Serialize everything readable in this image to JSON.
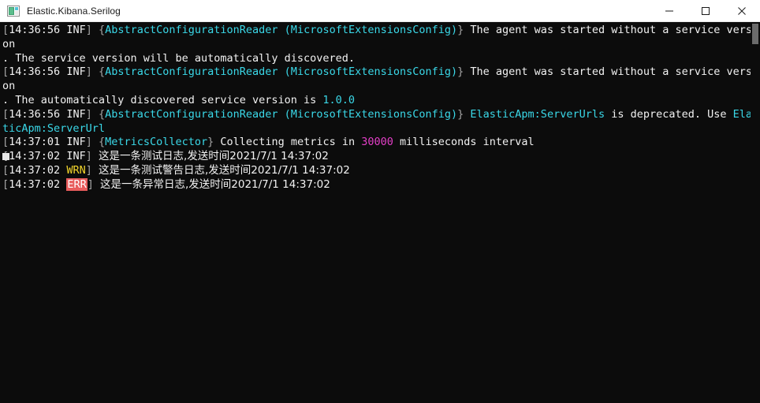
{
  "window": {
    "title": "Elastic.Kibana.Serilog",
    "icon": "console-app-icon",
    "controls": {
      "minimize_label": "Minimize",
      "maximize_label": "Maximize",
      "close_label": "Close"
    }
  },
  "colors": {
    "console_background": "#0c0c0c",
    "titlebar_background": "#ffffff",
    "default_text": "#f2f2f2",
    "bracket_gray": "#a5a5a5",
    "cyan_accent": "#3ad8e8",
    "magenta_accent": "#e43fc8",
    "warning_yellow": "#f5d72c",
    "error_badge_background": "#e85c5c",
    "error_badge_text": "#ffffff",
    "scrollbar_thumb": "#6b6b6b"
  },
  "console": {
    "lines": [
      {
        "id": "line-1",
        "level": "INF",
        "segments": [
          {
            "text": "[",
            "color": "gray"
          },
          {
            "text": "14:36:56",
            "color": "white"
          },
          {
            "text": " ",
            "color": "white"
          },
          {
            "text": "INF",
            "color": "white"
          },
          {
            "text": "] ",
            "color": "gray"
          },
          {
            "text": "{",
            "color": "gray"
          },
          {
            "text": "AbstractConfigurationReader (MicrosoftExtensionsConfig)",
            "color": "cyan"
          },
          {
            "text": "} ",
            "color": "gray"
          },
          {
            "text": "The agent was started without a service version",
            "color": "white"
          }
        ]
      },
      {
        "id": "line-2",
        "level": "cont",
        "segments": [
          {
            "text": ". The service version will be automatically discovered.",
            "color": "white"
          }
        ]
      },
      {
        "id": "line-3",
        "level": "INF",
        "segments": [
          {
            "text": "[",
            "color": "gray"
          },
          {
            "text": "14:36:56",
            "color": "white"
          },
          {
            "text": " ",
            "color": "white"
          },
          {
            "text": "INF",
            "color": "white"
          },
          {
            "text": "] ",
            "color": "gray"
          },
          {
            "text": "{",
            "color": "gray"
          },
          {
            "text": "AbstractConfigurationReader (MicrosoftExtensionsConfig)",
            "color": "cyan"
          },
          {
            "text": "} ",
            "color": "gray"
          },
          {
            "text": "The agent was started without a service version",
            "color": "white"
          }
        ]
      },
      {
        "id": "line-4",
        "level": "cont",
        "segments": [
          {
            "text": ". The automatically discovered service version is ",
            "color": "white"
          },
          {
            "text": "1.0.0",
            "color": "cyan"
          }
        ]
      },
      {
        "id": "line-5",
        "level": "INF",
        "segments": [
          {
            "text": "[",
            "color": "gray"
          },
          {
            "text": "14:36:56",
            "color": "white"
          },
          {
            "text": " ",
            "color": "white"
          },
          {
            "text": "INF",
            "color": "white"
          },
          {
            "text": "] ",
            "color": "gray"
          },
          {
            "text": "{",
            "color": "gray"
          },
          {
            "text": "AbstractConfigurationReader (MicrosoftExtensionsConfig)",
            "color": "cyan"
          },
          {
            "text": "} ",
            "color": "gray"
          },
          {
            "text": "ElasticApm:ServerUrls",
            "color": "cyan"
          },
          {
            "text": " is deprecated. Use ",
            "color": "white"
          },
          {
            "text": "ElasticApm:ServerUrl",
            "color": "cyan"
          }
        ]
      },
      {
        "id": "line-6",
        "level": "INF",
        "segments": [
          {
            "text": "[",
            "color": "gray"
          },
          {
            "text": "14:37:01",
            "color": "white"
          },
          {
            "text": " ",
            "color": "white"
          },
          {
            "text": "INF",
            "color": "white"
          },
          {
            "text": "] ",
            "color": "gray"
          },
          {
            "text": "{",
            "color": "gray"
          },
          {
            "text": "MetricsCollector",
            "color": "cyan"
          },
          {
            "text": "} ",
            "color": "gray"
          },
          {
            "text": "Collecting metrics in ",
            "color": "white"
          },
          {
            "text": "30000",
            "color": "magenta"
          },
          {
            "text": " milliseconds interval",
            "color": "white"
          }
        ]
      },
      {
        "id": "line-7",
        "level": "INF",
        "segments": [
          {
            "text": "[",
            "color": "gray"
          },
          {
            "text": "14:37:02",
            "color": "white"
          },
          {
            "text": " ",
            "color": "white"
          },
          {
            "text": "INF",
            "color": "white"
          },
          {
            "text": "] ",
            "color": "gray"
          },
          {
            "text": "这是一条测试日志,发送时间2021/7/1 14:37:02",
            "color": "white",
            "cjk": true
          }
        ]
      },
      {
        "id": "line-8",
        "level": "WRN",
        "segments": [
          {
            "text": "[",
            "color": "gray"
          },
          {
            "text": "14:37:02",
            "color": "white"
          },
          {
            "text": " ",
            "color": "white"
          },
          {
            "text": "WRN",
            "color": "yellow"
          },
          {
            "text": "] ",
            "color": "gray"
          },
          {
            "text": "这是一条测试警告日志,发送时间2021/7/1 14:37:02",
            "color": "white",
            "cjk": true
          }
        ]
      },
      {
        "id": "line-9",
        "level": "ERR",
        "segments": [
          {
            "text": "[",
            "color": "gray"
          },
          {
            "text": "14:37:02",
            "color": "white"
          },
          {
            "text": " ",
            "color": "white"
          },
          {
            "text": "ERR",
            "color": "errbadge"
          },
          {
            "text": "] ",
            "color": "gray"
          },
          {
            "text": "这是一条异常日志,发送时间2021/7/1 14:37:02",
            "color": "white",
            "cjk": true
          }
        ]
      }
    ],
    "cursor_visible": true
  },
  "scrollbar": {
    "thumb_visible": true
  }
}
